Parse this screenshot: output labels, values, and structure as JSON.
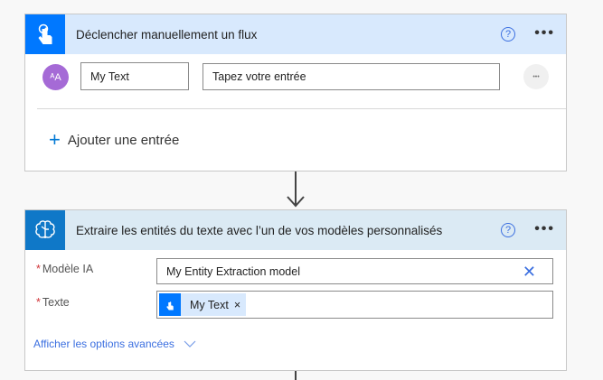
{
  "trigger": {
    "title": "Déclencher manuellement un flux",
    "help": "?",
    "more": "•••",
    "input_name": "My Text",
    "input_placeholder": "Tapez votre entrée",
    "row_more": "•••",
    "add_label": "Ajouter une entrée",
    "add_icon": "+"
  },
  "action": {
    "title": "Extraire les entités du texte avec l’un de vos modèles personnalisés",
    "help": "?",
    "more": "•••",
    "model_label": "Modèle IA",
    "model_value": "My Entity Extraction model",
    "text_label": "Texte",
    "token_label": "My Text",
    "token_remove": "×",
    "advanced": "Afficher les options avancées",
    "required": "*"
  },
  "colors": {
    "trigger_accent": "#0078ff",
    "trigger_header": "#d8e9fd",
    "action_accent": "#0f78c8",
    "action_header": "#dbeaf4"
  }
}
